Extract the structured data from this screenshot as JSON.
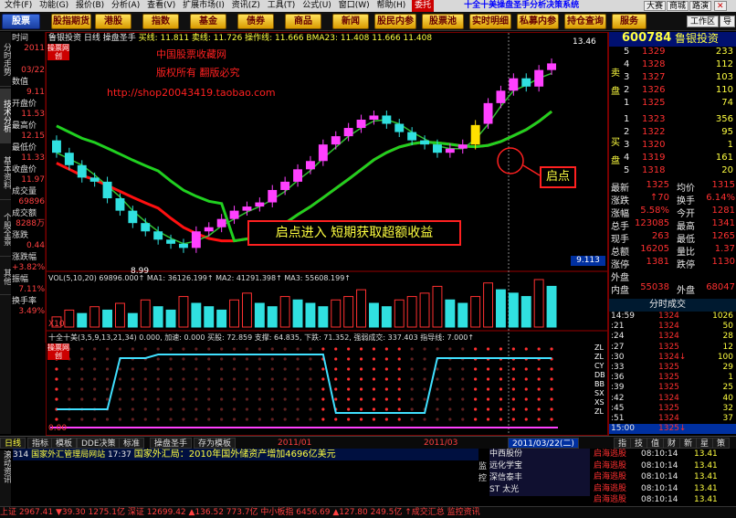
{
  "menubar": {
    "items": [
      "文件(F)",
      "功能(G)",
      "报价(B)",
      "分析(A)",
      "查看(V)",
      "扩展市场(I)",
      "资讯(Z)",
      "工具(T)",
      "公式(U)",
      "窗口(W)",
      "帮助(H)"
    ],
    "special": "委托",
    "title": "十全十美操盘圣手分析决策系统",
    "right": [
      "大赛",
      "商城",
      "路演"
    ]
  },
  "toolbar": {
    "buttons": [
      "股票",
      "股指期货",
      "港股",
      "指数",
      "基金",
      "债券",
      "商品",
      "新闻",
      "股民内参",
      "股票池",
      "实时明细",
      "私募内参",
      "持仓查询",
      "服务"
    ],
    "right": [
      "工作区",
      "导"
    ]
  },
  "side_tabs": [
    "分时走势",
    "技术分析",
    "基本资料",
    "个股全景",
    "其他"
  ],
  "left_info": [
    {
      "k": "时间",
      "v": "2011"
    },
    {
      "k": "",
      "v": "03/22"
    },
    {
      "k": "数值",
      "v": "9.11"
    },
    {
      "k": "开盘价",
      "v": "11.53"
    },
    {
      "k": "最高价",
      "v": "12.15"
    },
    {
      "k": "最低价",
      "v": "11.33"
    },
    {
      "k": "收盘价",
      "v": "11.97"
    },
    {
      "k": "成交量",
      "v": "69896"
    },
    {
      "k": "成交额",
      "v": "8288万"
    },
    {
      "k": "涨跌",
      "v": "0.44"
    },
    {
      "k": "涨跌幅",
      "v": "+3.82%"
    },
    {
      "k": "振幅",
      "v": "7.11%"
    },
    {
      "k": "换手率",
      "v": "3.49%"
    }
  ],
  "chart": {
    "header": {
      "name": "鲁银投资",
      "period": "日线",
      "indicator": "操盘圣手",
      "ma_labels": "买线: 11.811  卖线: 11.726  操作线: 11.666  BMA23: 11.408  11.666  11.408"
    },
    "badge": "操票网创",
    "watermark": [
      "中国股票收藏网",
      "版权所有  翻版必究",
      "http://shop20043419.taobao.com"
    ],
    "annot_start": "启点",
    "annot_entry": "启点进入  短期获取超额收益",
    "high_label": "13.46",
    "low_label": "8.99",
    "price_now": "9.113",
    "vol_header": "VOL(5,10,20)  69896.000↑ MA1: 36126.199↑ MA2: 41291.398↑ MA3: 55608.199↑",
    "vol_scale": "X10",
    "ind_header": "十全十美(3,5,9,13,21,34)  0.000, 加速: 0.000  买股: 72.859  支撑: 64.835, 下跌: 71.352, 强弱成交: 337.403 指导线: 7.000↑",
    "ind_right": [
      "ZL",
      "ZL",
      "CY",
      "DB",
      "BB",
      "SX",
      "XS",
      "ZL"
    ],
    "ind_scale": [
      "0.00"
    ],
    "date_axis": [
      "日线",
      "2011/01",
      "2011/03",
      "2011/03/22(二)"
    ],
    "volbars": [
      3,
      5,
      4,
      6,
      5,
      7,
      4,
      8,
      6,
      5,
      9,
      7,
      6,
      5,
      8,
      10,
      7,
      6,
      9,
      8,
      7,
      6,
      8,
      9,
      11,
      7,
      6,
      8,
      9,
      10,
      12,
      8,
      7,
      9,
      13,
      11,
      10,
      9,
      14,
      12
    ]
  },
  "chart_data": {
    "type": "candlestick",
    "candles": [
      {
        "o": 11.6,
        "c": 11.3
      },
      {
        "o": 11.3,
        "c": 11.0
      },
      {
        "o": 11.0,
        "c": 10.7
      },
      {
        "o": 10.7,
        "c": 10.6
      },
      {
        "o": 10.6,
        "c": 10.2
      },
      {
        "o": 10.2,
        "c": 9.9
      },
      {
        "o": 9.9,
        "c": 9.6
      },
      {
        "o": 9.6,
        "c": 9.4
      },
      {
        "o": 9.4,
        "c": 9.2
      },
      {
        "o": 9.2,
        "c": 9.1
      },
      {
        "o": 9.1,
        "c": 9.0
      },
      {
        "o": 9.0,
        "c": 9.4
      },
      {
        "o": 9.4,
        "c": 9.5
      },
      {
        "o": 9.5,
        "c": 9.7
      },
      {
        "o": 9.7,
        "c": 9.9
      },
      {
        "o": 9.9,
        "c": 10.0
      },
      {
        "o": 10.0,
        "c": 10.1
      },
      {
        "o": 10.1,
        "c": 10.4
      },
      {
        "o": 10.4,
        "c": 10.6
      },
      {
        "o": 10.6,
        "c": 10.9
      },
      {
        "o": 10.9,
        "c": 11.1
      },
      {
        "o": 11.1,
        "c": 11.5
      },
      {
        "o": 11.5,
        "c": 11.7
      },
      {
        "o": 11.7,
        "c": 11.9
      },
      {
        "o": 11.9,
        "c": 12.1
      },
      {
        "o": 12.1,
        "c": 12.2
      },
      {
        "o": 12.2,
        "c": 12.0
      },
      {
        "o": 12.0,
        "c": 11.8
      },
      {
        "o": 11.8,
        "c": 11.6
      },
      {
        "o": 11.6,
        "c": 11.5
      },
      {
        "o": 11.5,
        "c": 11.3
      },
      {
        "o": 11.3,
        "c": 11.4
      },
      {
        "o": 11.4,
        "c": 11.5
      },
      {
        "o": 11.5,
        "c": 11.97
      },
      {
        "o": 12.0,
        "c": 12.5
      },
      {
        "o": 12.5,
        "c": 12.8
      },
      {
        "o": 12.8,
        "c": 13.1
      },
      {
        "o": 13.1,
        "c": 12.9
      },
      {
        "o": 12.9,
        "c": 13.3
      },
      {
        "o": 13.3,
        "c": 13.46
      }
    ],
    "ylim": [
      8.5,
      13.8
    ]
  },
  "quote": {
    "code": "600784",
    "name": "鲁银投资",
    "sell_label": "卖盘",
    "buy_label": "买盘",
    "sell": [
      {
        "lvl": "5",
        "p": "1329",
        "v": "233"
      },
      {
        "lvl": "4",
        "p": "1328",
        "v": "112"
      },
      {
        "lvl": "3",
        "p": "1327",
        "v": "103"
      },
      {
        "lvl": "2",
        "p": "1326",
        "v": "110"
      },
      {
        "lvl": "1",
        "p": "1325",
        "v": "74"
      }
    ],
    "buy": [
      {
        "lvl": "1",
        "p": "1323",
        "v": "356"
      },
      {
        "lvl": "2",
        "p": "1322",
        "v": "95"
      },
      {
        "lvl": "3",
        "p": "1320",
        "v": "1"
      },
      {
        "lvl": "4",
        "p": "1319",
        "v": "161"
      },
      {
        "lvl": "5",
        "p": "1318",
        "v": "20"
      }
    ],
    "details": [
      {
        "k1": "最新",
        "v1": "1325",
        "k2": "均价",
        "v2": "1315"
      },
      {
        "k1": "涨跌",
        "v1": "↑70",
        "k2": "换手",
        "v2": "6.14%"
      },
      {
        "k1": "涨幅",
        "v1": "5.58%",
        "k2": "今开",
        "v2": "1281"
      },
      {
        "k1": "总手",
        "v1": "123085",
        "k2": "最高",
        "v2": "1341"
      },
      {
        "k1": "现手",
        "v1": "263",
        "k2": "最低",
        "v2": "1265"
      },
      {
        "k1": "总额",
        "v1": "16205",
        "k2": "量比",
        "v2": "1.37"
      },
      {
        "k1": "涨停",
        "v1": "1381",
        "k2": "跌停",
        "v2": "1130"
      },
      {
        "k1": "外盘",
        "v1": "",
        "k2": "",
        "v2": ""
      },
      {
        "k1": "内盘",
        "v1": "55038",
        "k2": "外盘",
        "v2": "68047"
      }
    ],
    "ticks_title": "分时成交",
    "ticks": [
      {
        "t": "14:59",
        "p": "1324",
        "v": "1026"
      },
      {
        "t": ":21",
        "p": "1324",
        "v": "50"
      },
      {
        "t": ":24",
        "p": "1324",
        "v": "28"
      },
      {
        "t": ":27",
        "p": "1325",
        "v": "12"
      },
      {
        "t": ":30",
        "p": "1324↓",
        "v": "100"
      },
      {
        "t": ":33",
        "p": "1325",
        "v": "29"
      },
      {
        "t": ":36",
        "p": "1325",
        "v": "1"
      },
      {
        "t": ":39",
        "p": "1325",
        "v": "25"
      },
      {
        "t": ":42",
        "p": "1324",
        "v": "40"
      },
      {
        "t": ":45",
        "p": "1325",
        "v": "32"
      },
      {
        "t": ":51",
        "p": "1324",
        "v": "37"
      },
      {
        "t": "15:00",
        "p": "1325↓",
        "v": ""
      }
    ]
  },
  "bottom_tabs": [
    "指标",
    "模板",
    "DDE决策",
    "标准",
    "操盘圣手",
    "存为模板"
  ],
  "right_tabs": [
    "指",
    "技",
    "值",
    "财",
    "新",
    "星",
    "策"
  ],
  "news": {
    "left_label": "滚动资讯",
    "headline_count": "314",
    "headline_src": "国家外汇管理局网站",
    "headline_time": "17:37",
    "headline_text": "国家外汇局：2010年国外储资产增加4696亿美元",
    "side": [
      "中西股份",
      "远化学宝",
      "深信泰丰",
      "ST 太光"
    ],
    "side_labels": [
      "监",
      "控"
    ],
    "right_rows": [
      {
        "name": "启海逃股",
        "time": "08:10:14",
        "val": "13.41"
      },
      {
        "name": "启海逃股",
        "time": "08:10:14",
        "val": "13.41"
      },
      {
        "name": "启海逃股",
        "time": "08:10:14",
        "val": "13.41"
      },
      {
        "name": "启海逃股",
        "time": "08:10:14",
        "val": "13.41"
      },
      {
        "name": "启海逃股",
        "time": "08:10:14",
        "val": "13.41"
      }
    ],
    "statusbar": "上证 2967.41  ▼39.30  1275.1亿 深证 12699.42 ▲136.52  773.7亿 中小板指  6456.69  ▲127.80  249.5亿  ↑成交汇总 监控资讯"
  }
}
